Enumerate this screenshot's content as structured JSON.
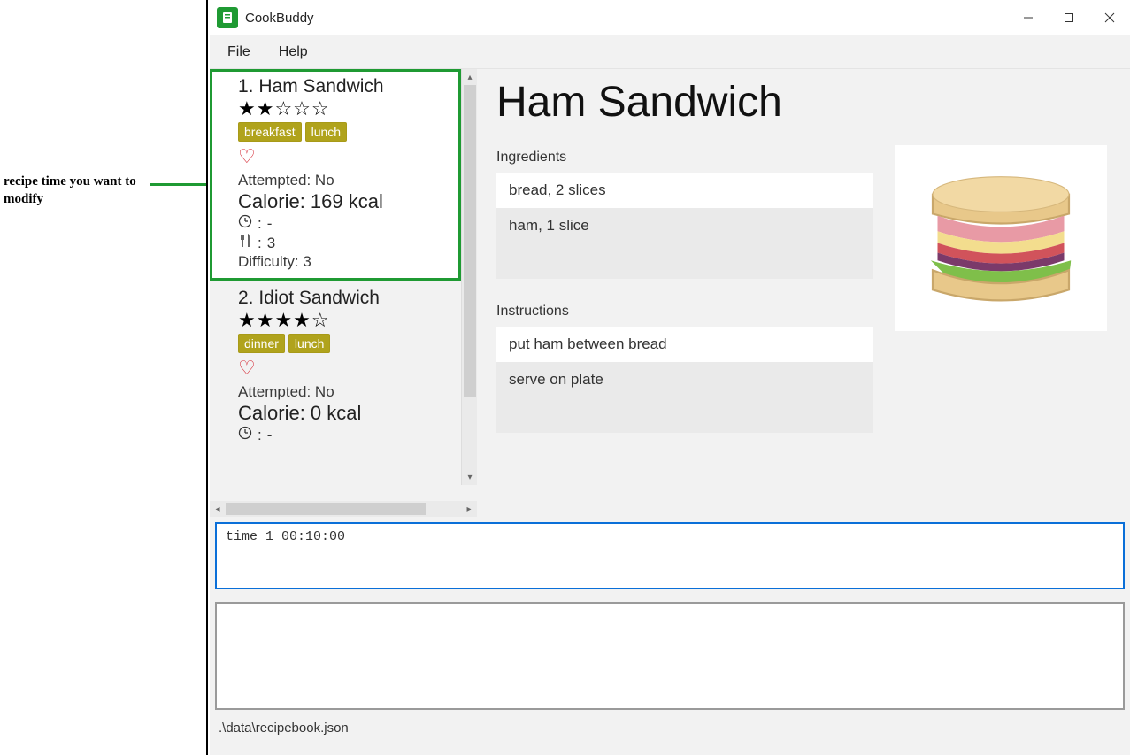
{
  "annotation": {
    "text": "recipe time you want to modify"
  },
  "window": {
    "title": "CookBuddy"
  },
  "menubar": {
    "file": "File",
    "help": "Help"
  },
  "recipes": [
    {
      "number": "1.",
      "title_line": "1.   Ham Sandwich",
      "stars_display": "★★☆☆☆",
      "tags": [
        "breakfast",
        "lunch"
      ],
      "favorite": true,
      "attempted": "Attempted: No",
      "calorie": "Calorie: 169 kcal",
      "time_row": "-",
      "serving_row": "3",
      "difficulty": "Difficulty: 3",
      "selected": true
    },
    {
      "number": "2.",
      "title_line": "2.   Idiot Sandwich",
      "stars_display": "★★★★☆",
      "tags": [
        "dinner",
        "lunch"
      ],
      "favorite": true,
      "attempted": "Attempted: No",
      "calorie": "Calorie: 0 kcal",
      "time_row": "-",
      "selected": false
    }
  ],
  "detail": {
    "title": "Ham Sandwich",
    "ingredients_label": "Ingredients",
    "ingredients": [
      "bread, 2 slices",
      "ham, 1 slice"
    ],
    "instructions_label": "Instructions",
    "instructions": [
      "put ham between bread",
      "serve on plate"
    ]
  },
  "command": {
    "value": "time 1 00:10:00"
  },
  "output": {
    "value": ""
  },
  "statusbar": {
    "text": ".\\data\\recipebook.json"
  },
  "icons": {
    "clock": "clock-icon",
    "serving": "fork-knife-icon",
    "heart": "heart-icon"
  }
}
